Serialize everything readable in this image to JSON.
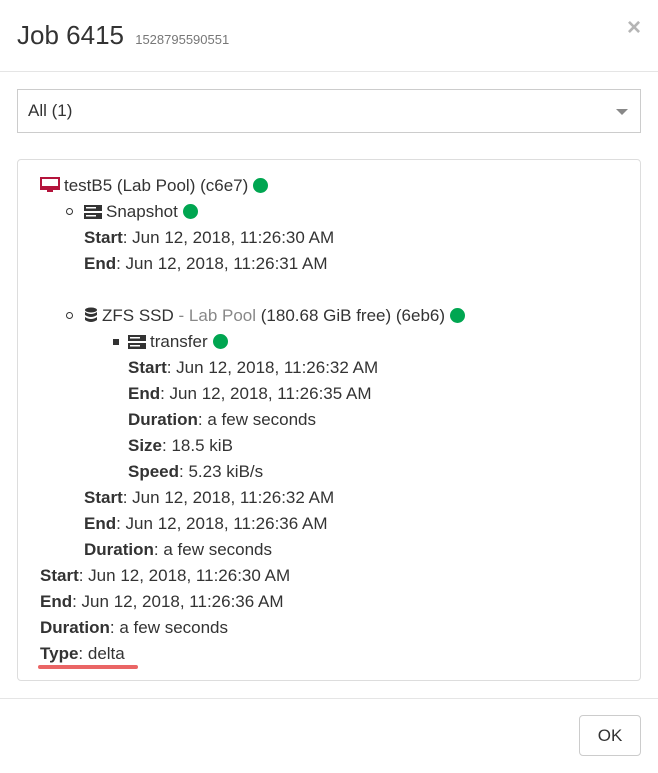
{
  "header": {
    "title": "Job 6415",
    "job_id": "1528795590551",
    "close_label": "×"
  },
  "filter": {
    "selected": "All (1)"
  },
  "tree": {
    "machine": {
      "name": "testB5 (Lab Pool) (c6e7)",
      "status_color": "#00a651",
      "icon": "monitor-icon"
    },
    "snapshot": {
      "label": "Snapshot",
      "icon": "server-icon",
      "start_label": "Start",
      "start": ": Jun 12, 2018, 11:26:30 AM",
      "end_label": "End",
      "end": ": Jun 12, 2018, 11:26:31 AM"
    },
    "storage": {
      "name": "ZFS SSD",
      "pool": " - Lab Pool",
      "detail": " (180.68 GiB free) (6eb6)",
      "icon": "database-icon",
      "transfer": {
        "label": "transfer",
        "icon": "server-icon",
        "start_label": "Start",
        "start": ": Jun 12, 2018, 11:26:32 AM",
        "end_label": "End",
        "end": ": Jun 12, 2018, 11:26:35 AM",
        "duration_label": "Duration",
        "duration": ": a few seconds",
        "size_label": "Size",
        "size": ": 18.5 kiB",
        "speed_label": "Speed",
        "speed": ": 5.23 kiB/s"
      },
      "start_label": "Start",
      "start": ": Jun 12, 2018, 11:26:32 AM",
      "end_label": "End",
      "end": ": Jun 12, 2018, 11:26:36 AM",
      "duration_label": "Duration",
      "duration": ": a few seconds"
    },
    "job": {
      "start_label": "Start",
      "start": ": Jun 12, 2018, 11:26:30 AM",
      "end_label": "End",
      "end": ": Jun 12, 2018, 11:26:36 AM",
      "duration_label": "Duration",
      "duration": ": a few seconds",
      "type_label": "Type",
      "type": ": delta"
    }
  },
  "footer": {
    "ok_label": "OK"
  }
}
